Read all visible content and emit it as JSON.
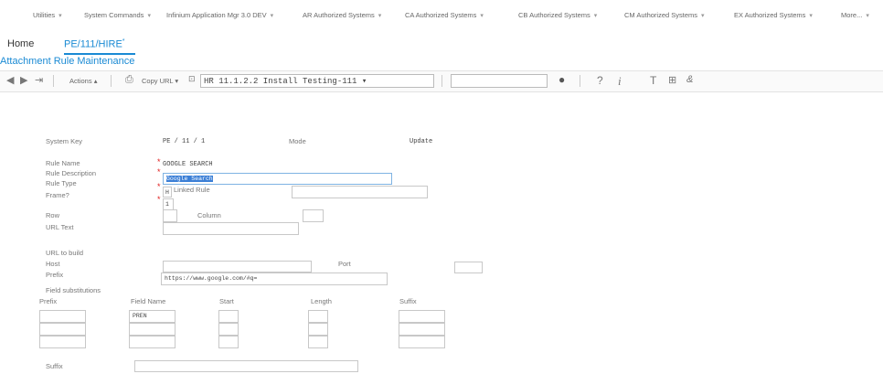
{
  "menu": {
    "items": [
      {
        "label": "Utilities"
      },
      {
        "label": "System Commands"
      },
      {
        "label": "Infinium Application Mgr 3.0 DEV"
      },
      {
        "label": "AR Authorized Systems"
      },
      {
        "label": "CA Authorized Systems"
      },
      {
        "label": "CB Authorized Systems"
      },
      {
        "label": "CM Authorized Systems"
      },
      {
        "label": "EX Authorized Systems"
      },
      {
        "label": "More..."
      }
    ]
  },
  "tabs": {
    "home": "Home",
    "active": "PE/111/HIRE",
    "active_marker": "*"
  },
  "page_title": "Attachment Rule Maintenance",
  "toolbar": {
    "actions": "Actions",
    "copy_url": "Copy URL",
    "session": "HR 11.1.2.2 Install Testing-111",
    "search_value": ""
  },
  "form": {
    "system_key_label": "System Key",
    "system_key_value": "PE / 11 / 1",
    "mode_label": "Mode",
    "mode_value": "Update",
    "rule_name_label": "Rule Name",
    "rule_name_value": "GOOGLE SEARCH",
    "rule_desc_label": "Rule Description",
    "rule_desc_value": "Google Search",
    "rule_type_label": "Rule Type",
    "rule_type_value": "H",
    "linked_rule_label": "Linked Rule",
    "linked_rule_value": "",
    "frame_label": "Frame?",
    "frame_value": "1",
    "row_label": "Row",
    "row_value": "",
    "column_label": "Column",
    "column_value": "",
    "url_text_label": "URL Text",
    "url_text_value": "",
    "url_build_label": "URL to build",
    "host_label": "Host",
    "host_value": "",
    "port_label": "Port",
    "port_value": "",
    "prefix_label": "Prefix",
    "prefix_value": "https://www.google.com/#q=",
    "field_subst_label": "Field substitutions",
    "suffix_label": "Suffix",
    "suffix_value": ""
  },
  "substitutions": {
    "headers": {
      "prefix": "Prefix",
      "field_name": "Field Name",
      "start": "Start",
      "length": "Length",
      "suffix": "Suffix"
    },
    "rows": [
      {
        "prefix": "",
        "field_name": "PREN",
        "start": "",
        "length": "",
        "suffix": ""
      },
      {
        "prefix": "",
        "field_name": "",
        "start": "",
        "length": "",
        "suffix": ""
      },
      {
        "prefix": "",
        "field_name": "",
        "start": "",
        "length": "",
        "suffix": ""
      }
    ]
  }
}
